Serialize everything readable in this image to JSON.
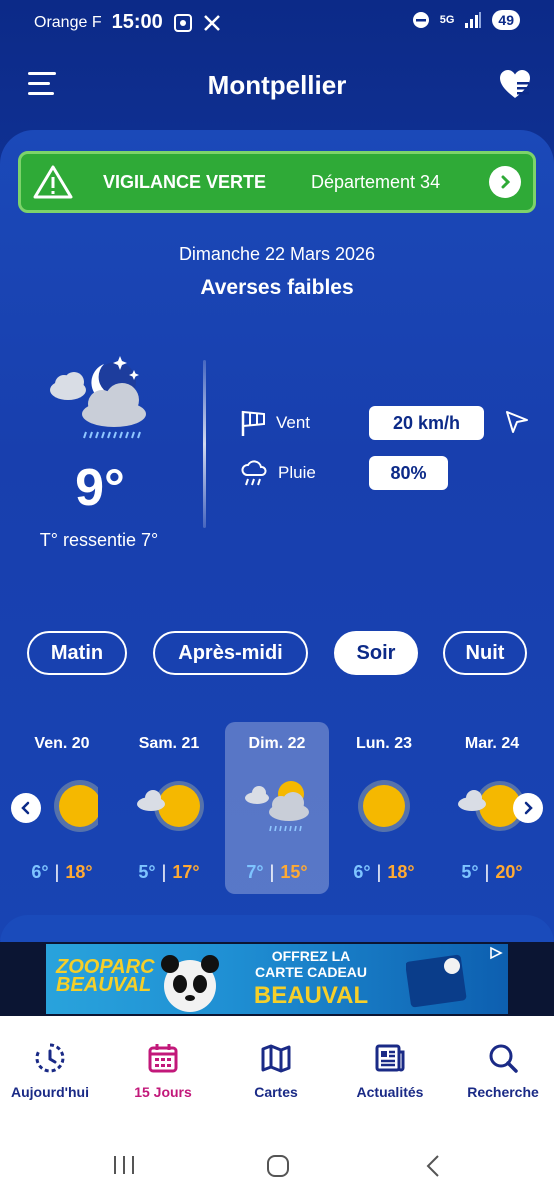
{
  "status": {
    "carrier": "Orange F",
    "time": "15:00",
    "network": "5G",
    "battery": "49"
  },
  "header": {
    "title": "Montpellier"
  },
  "vigilance": {
    "label": "VIGILANCE VERTE",
    "department": "Département 34"
  },
  "current": {
    "date": "Dimanche 22 Mars 2026",
    "condition": "Averses faibles",
    "temperature": "9°",
    "feels_like": "T° ressentie 7°",
    "wind_label": "Vent",
    "wind_value": "20 km/h",
    "rain_label": "Pluie",
    "rain_value": "80%"
  },
  "periods": [
    {
      "label": "Matin"
    },
    {
      "label": "Après-midi"
    },
    {
      "label": "Soir"
    },
    {
      "label": "Nuit"
    }
  ],
  "selected_period": "Soir",
  "days": [
    {
      "name": "Ven. 20",
      "min": "6°",
      "max": "18°",
      "icon": "sun-icon"
    },
    {
      "name": "Sam. 21",
      "min": "5°",
      "max": "17°",
      "icon": "sun-cloud-icon"
    },
    {
      "name": "Dim. 22",
      "min": "7°",
      "max": "15°",
      "icon": "sun-rain-cloud-icon"
    },
    {
      "name": "Lun. 23",
      "min": "6°",
      "max": "18°",
      "icon": "sun-icon"
    },
    {
      "name": "Mar. 24",
      "min": "5°",
      "max": "20°",
      "icon": "sun-cloud-icon"
    }
  ],
  "ad": {
    "brand": "ZOOPARC BEAUVAL",
    "line1": "OFFREZ LA",
    "line2": "CARTE CADEAU",
    "line3": "BEAUVAL"
  },
  "nav": [
    {
      "label": "Aujourd'hui"
    },
    {
      "label": "15 Jours"
    },
    {
      "label": "Cartes"
    },
    {
      "label": "Actualités"
    },
    {
      "label": "Recherche"
    }
  ],
  "colors": {
    "vigilance": "#2faa37",
    "accent": "#c2187a",
    "min_temp": "#7ec4ff",
    "max_temp": "#ffaa33"
  }
}
